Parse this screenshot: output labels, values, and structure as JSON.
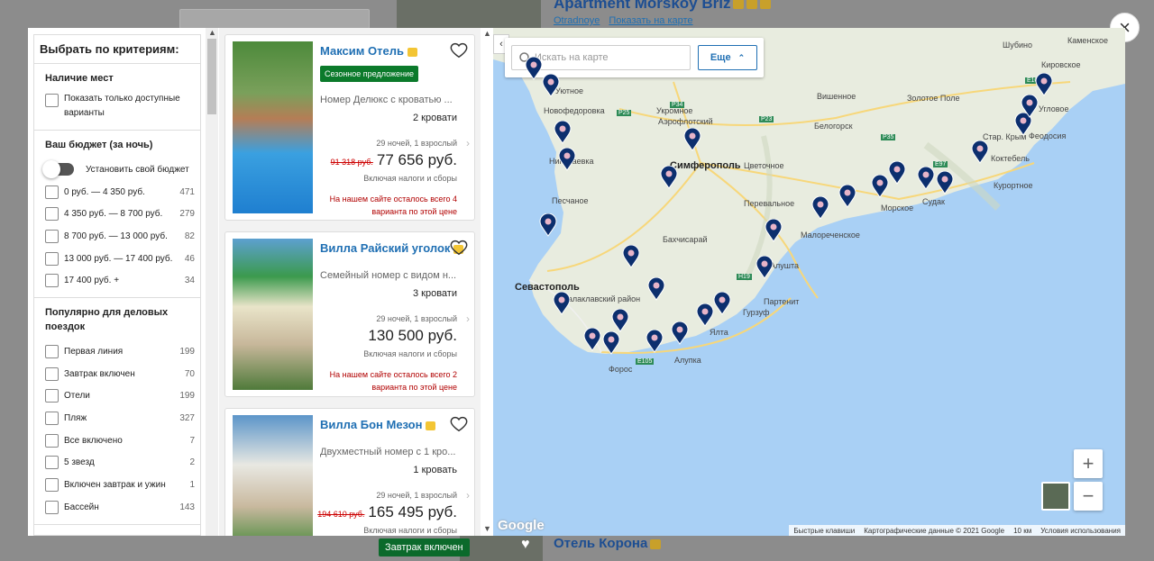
{
  "background": {
    "hotel_top_title": "Apartment Morskoy Briz",
    "hotel_top_location": "Otradnoye",
    "hotel_top_map_link": "Показать на карте",
    "hotel_bottom_title": "Отель Корона",
    "hotel_bottom_badge": "Завтрак включен"
  },
  "close_label": "×",
  "filters": {
    "title": "Выбрать по критериям:",
    "availability": {
      "heading": "Наличие мест",
      "option": "Показать только доступные варианты"
    },
    "budget": {
      "heading": "Ваш бюджет (за ночь)",
      "toggle_label": "Установить свой бюджет",
      "ranges": [
        {
          "label": "0 руб. — 4 350 руб.",
          "count": "471"
        },
        {
          "label": "4 350 руб. — 8 700 руб.",
          "count": "279"
        },
        {
          "label": "8 700 руб. — 13 000 руб.",
          "count": "82"
        },
        {
          "label": "13 000 руб. — 17 400 руб.",
          "count": "46"
        },
        {
          "label": "17 400 руб. +",
          "count": "34"
        }
      ]
    },
    "business": {
      "heading": "Популярно для деловых поездок",
      "options": [
        {
          "label": "Первая линия",
          "count": "199"
        },
        {
          "label": "Завтрак включен",
          "count": "70"
        },
        {
          "label": "Отели",
          "count": "199"
        },
        {
          "label": "Пляж",
          "count": "327"
        },
        {
          "label": "Все включено",
          "count": "7"
        },
        {
          "label": "5 звезд",
          "count": "2"
        },
        {
          "label": "Включен завтрак и ужин",
          "count": "1"
        },
        {
          "label": "Бассейн",
          "count": "143"
        }
      ]
    }
  },
  "results": [
    {
      "name": "Максим Отель",
      "promo": "Сезонное предложение",
      "room": "Номер Делюкс с кроватью ...",
      "beds": "2 кровати",
      "nights": "29 ночей, 1 взрослый",
      "old_price": "91 318 руб.",
      "price": "77 656 руб.",
      "tax": "Включая налоги и сборы",
      "warning": "На нашем сайте осталось всего 4 варианта по этой цене"
    },
    {
      "name": "Вилла Райский уголок",
      "promo": "",
      "room": "Семейный номер с видом н...",
      "beds": "3 кровати",
      "nights": "29 ночей, 1 взрослый",
      "old_price": "",
      "price": "130 500 руб.",
      "tax": "Включая налоги и сборы",
      "warning": "На нашем сайте осталось всего 2 варианта по этой цене"
    },
    {
      "name": "Вилла Бон Мезон",
      "promo": "",
      "room": "Двухместный номер с 1 кро...",
      "beds": "1 кровать",
      "nights": "29 ночей, 1 взрослый",
      "old_price": "194 610 руб.",
      "price": "165 495 руб.",
      "tax": "Включая налоги и сборы",
      "warning": ""
    }
  ],
  "map": {
    "search_placeholder": "Искать на карте",
    "more_button": "Еще",
    "zoom_in": "+",
    "zoom_out": "−",
    "google_logo": "Google",
    "attribution": [
      "Быстрые клавиши",
      "Картографические данные © 2021 Google",
      "10 км",
      "Условия использования"
    ],
    "cities": [
      "Шубино",
      "Каменское",
      "Кировское",
      "Новофедоровка",
      "Уютное",
      "Угловое",
      "Укромное",
      "Аэрофлотский",
      "Вишенное",
      "Золотое Поле",
      "Белогорск",
      "Стар. Крым",
      "Феодосия",
      "Коктебель",
      "Курортное",
      "Симферополь",
      "Николаевка",
      "Песчаное",
      "Цветочное",
      "Перевальное",
      "Морское",
      "Судак",
      "Малореченское",
      "Бахчисарай",
      "Алушта",
      "Севастополь",
      "Балаклавский район",
      "Партенит",
      "Гурзуф",
      "Ялта",
      "Алупка",
      "Форос"
    ],
    "road_labels": [
      "P25",
      "P23",
      "P35",
      "E97",
      "E105",
      "P34",
      "H19",
      "E105"
    ]
  }
}
